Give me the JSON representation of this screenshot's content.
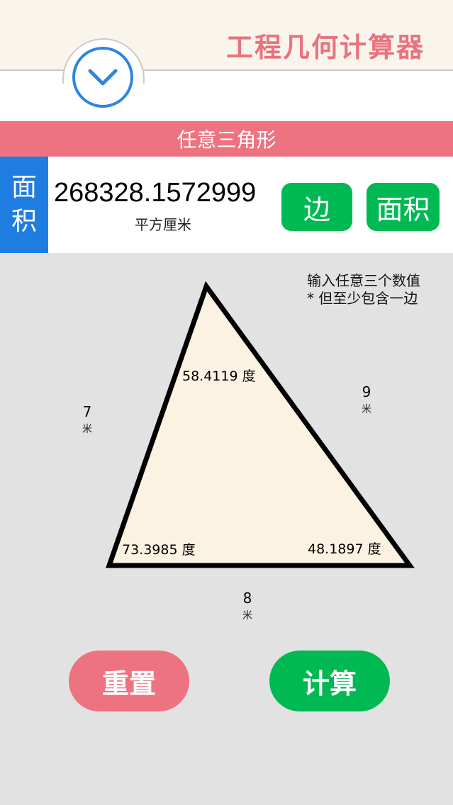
{
  "colors": {
    "accent_pink": "#ee7380",
    "accent_green": "#00b953",
    "accent_blue": "#1f7ce0",
    "triangle_fill": "#fbf2e2",
    "background": "#e2e2e2"
  },
  "header": {
    "app_title": "工程几何计算器",
    "collapse_icon": "chevron-down-icon"
  },
  "section": {
    "title": "任意三角形"
  },
  "result": {
    "mode_char_1": "面",
    "mode_char_2": "积",
    "value": "268328.1572999",
    "unit": "平方厘米",
    "side_button_label": "边",
    "area_button_label": "面积"
  },
  "hint": {
    "line1": "输入任意三个数值",
    "line2": "* 但至少包含一边"
  },
  "triangle": {
    "angle_top": "58.4119 度",
    "angle_bottom_left": "73.3985 度",
    "angle_bottom_right": "48.1897 度",
    "side_left": {
      "value": "7",
      "unit": "米"
    },
    "side_right": {
      "value": "9",
      "unit": "米"
    },
    "side_bottom": {
      "value": "8",
      "unit": "米"
    }
  },
  "buttons": {
    "reset": "重置",
    "calculate": "计算"
  }
}
